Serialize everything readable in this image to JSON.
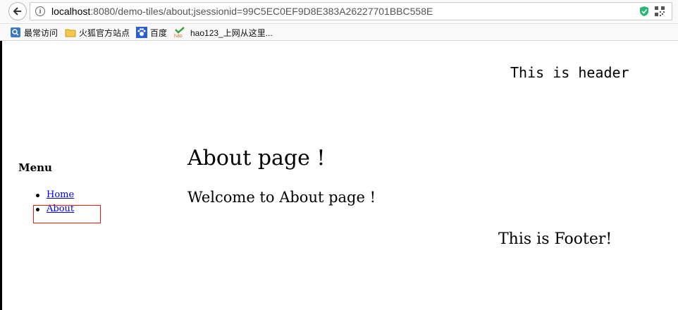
{
  "browser": {
    "url_host": "localhost",
    "url_rest": ":8080/demo-tiles/about;jsessionid=99C5EC0EF9D8E383A26227701BBC558E",
    "bookmarks": [
      {
        "label": "最常访问",
        "icon": "search-bookmark-icon"
      },
      {
        "label": "火狐官方站点",
        "icon": "folder-icon"
      },
      {
        "label": "百度",
        "icon": "paw-icon"
      },
      {
        "label": "hao123_上网从这里...",
        "icon": "hao-icon"
      }
    ]
  },
  "page": {
    "header": "This is header",
    "menu": {
      "title": "Menu",
      "items": [
        {
          "label": "Home"
        },
        {
          "label": "About"
        }
      ]
    },
    "title": "About page !",
    "welcome": "Welcome to About page !",
    "footer": "This is Footer!"
  },
  "colors": {
    "link": "#0000ee",
    "highlight": "#e0191a",
    "shield": "#2bb673"
  }
}
